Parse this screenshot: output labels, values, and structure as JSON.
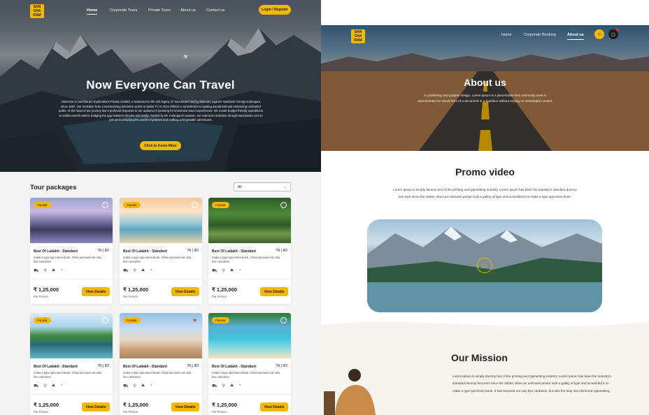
{
  "brand": {
    "logo_text": "SAN CHA RAM",
    "accent": "#f5b800"
  },
  "left": {
    "nav": {
      "links": [
        "Home",
        "Corporate Tours",
        "Private Tours",
        "About us",
        "Contact us"
      ],
      "active": "Home",
      "login_label": "Login / Register"
    },
    "hero": {
      "title": "Now Everyone Can Travel",
      "description": "Welcome to Sancharam Explorations Private Limited, a testament to the rich legacy of 'Sancharam' led by visionary explorer Santhosh George Kulangara since 1997. Our evolution from a mesmerizing television series to Safari TV in 2013 reflects a commitment to igniting wanderlust and embracing uncharted paths. At the heart of our journey lies a profound response to our audience's yearning for immersive travel experiences. We curate budget-friendly expeditions to undiscovered realms, bridging the gap between dreams and reality. Guided by Mr. Kulangara's passion, we extend an invitation through sancharam.com to join us in unlocking the world's mysteries and crafting unforgettable adventures.",
      "cta_label": "Click to Know More"
    },
    "tour_section": {
      "title": "Tour packages",
      "filter_value": "All"
    },
    "cards": [
      {
        "badge": "Popular",
        "name": "Best Of Ladakh - Standard",
        "duration": "7N | 8D",
        "text": "make a type specimen book. It has survived not only five centuries.",
        "price": "₹ 1,25,000",
        "per": "Per Person",
        "button": "View Details",
        "fav": false
      },
      {
        "badge": "Popular",
        "name": "Best Of Ladakh - Standard",
        "duration": "7N | 8D",
        "text": "make a type specimen book. It has survived not only five centuries.",
        "price": "₹ 1,25,000",
        "per": "Per Person",
        "button": "View Details",
        "fav": false
      },
      {
        "badge": "Popular",
        "name": "Best Of Ladakh - Standard",
        "duration": "7N | 8D",
        "text": "make a type specimen book. It has survived not only five centuries.",
        "price": "₹ 1,25,000",
        "per": "Per Person",
        "button": "View Details",
        "fav": false
      },
      {
        "badge": "Popular",
        "name": "Best Of Ladakh - Standard",
        "duration": "7N | 8D",
        "text": "make a type specimen book. It has survived not only five centuries.",
        "price": "₹ 1,25,000",
        "per": "Per Person",
        "button": "View Details",
        "fav": false
      },
      {
        "badge": "Popular",
        "name": "Best Of Ladakh - Standard",
        "duration": "7N | 8D",
        "text": "make a type specimen book. It has survived not only five centuries.",
        "price": "₹ 1,25,000",
        "per": "Per Person",
        "button": "View Details",
        "fav": true
      },
      {
        "badge": "Popular",
        "name": "Best Of Ladakh - Standard",
        "duration": "7N | 8D",
        "text": "make a type specimen book. It has survived not only five centuries.",
        "price": "₹ 1,25,000",
        "per": "Per Person",
        "button": "View Details",
        "fav": false
      }
    ],
    "amenity_icons": [
      "car-icon",
      "bike-icon",
      "mountain-icon",
      "meal-icon"
    ]
  },
  "right": {
    "nav": {
      "links": [
        "Home",
        "Corporate Booking",
        "About us"
      ],
      "active": "About us"
    },
    "hero": {
      "title": "About us",
      "description": "In publishing and graphic design, Lorem ipsum is a placeholder text commonly used to demonstrate the visual form of a document or a typeface without relying on meaningful content."
    },
    "promo": {
      "title": "Promo video",
      "text": "Lorem Ipsum is simply dummy text of the printing and typesetting industry. Lorem Ipsum has been the industry's standard dummy text ever since the 1500s, when an unknown printer took a galley of type and scrambled it to make a type specimen book."
    },
    "mission": {
      "title": "Our Mission",
      "text": "Lorem Ipsum is simply dummy text of the printing and typesetting industry. Lorem Ipsum has been the industry's standard dummy text ever since the 1500s, when an unknown printer took a galley of type and scrambled it to make a type specimen book. It has survived not only five centuries, but also the leap into electronic typesetting."
    }
  }
}
